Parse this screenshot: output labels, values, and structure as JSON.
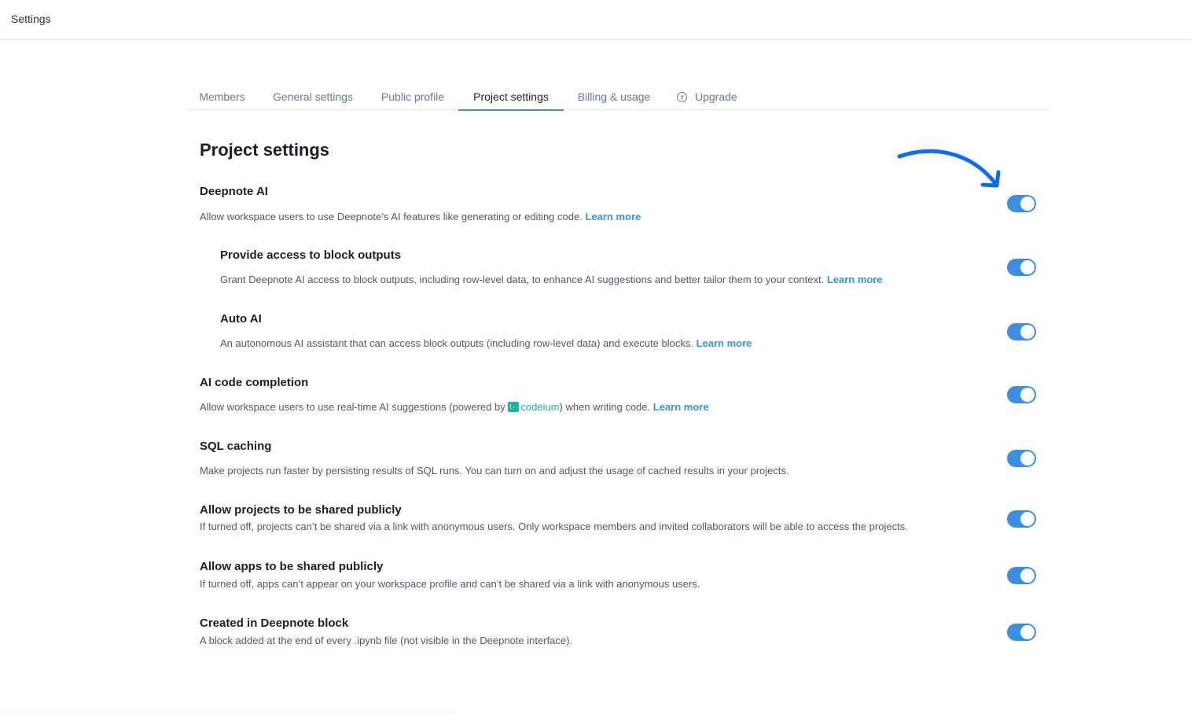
{
  "topbar": {
    "title": "Settings"
  },
  "tabs": [
    {
      "label": "Members",
      "active": false
    },
    {
      "label": "General settings",
      "active": false
    },
    {
      "label": "Public profile",
      "active": false
    },
    {
      "label": "Project settings",
      "active": true
    },
    {
      "label": "Billing & usage",
      "active": false
    },
    {
      "label": "Upgrade",
      "active": false,
      "icon": "arrow-up-circle-icon"
    }
  ],
  "page": {
    "heading": "Project settings"
  },
  "settings": [
    {
      "title": "Deepnote AI",
      "description": "Allow workspace users to use Deepnote’s AI features like generating or editing code.",
      "link": "Learn more",
      "enabled": true
    },
    {
      "title": "Provide access to block outputs",
      "description": "Grant Deepnote AI access to block outputs, including row-level data, to enhance AI suggestions and better tailor them to your context.",
      "link": "Learn more",
      "enabled": true
    },
    {
      "title": "Auto AI",
      "description": "An autonomous AI assistant that can access block outputs (including row-level data) and execute blocks.",
      "link": "Learn more",
      "enabled": true
    },
    {
      "title": "AI code completion",
      "description_before": "Allow workspace users to use real-time AI suggestions (powered by",
      "brand": "codeium",
      "description_after": ") when writing code.",
      "link": "Learn more",
      "enabled": true
    },
    {
      "title": "SQL caching",
      "description": "Make projects run faster by persisting results of SQL runs. You can turn on and adjust the usage of cached results in your projects.",
      "enabled": true
    },
    {
      "title": "Allow projects to be shared publicly",
      "description": "If turned off, projects can’t be shared via a link with anonymous users. Only workspace members and invited collaborators will be able to access the projects.",
      "enabled": true
    },
    {
      "title": "Allow apps to be shared publicly",
      "description": "If turned off, apps can’t appear on your workspace profile and can’t be shared via a link with anonymous users.",
      "enabled": true
    },
    {
      "title": "Created in Deepnote block",
      "description": "A block added at the end of every .ipynb file (not visible in the Deepnote interface).",
      "enabled": true
    }
  ],
  "colors": {
    "accent": "#3b8ee6",
    "annotation_arrow": "#0a6cff",
    "codeium": "#17b89a"
  }
}
